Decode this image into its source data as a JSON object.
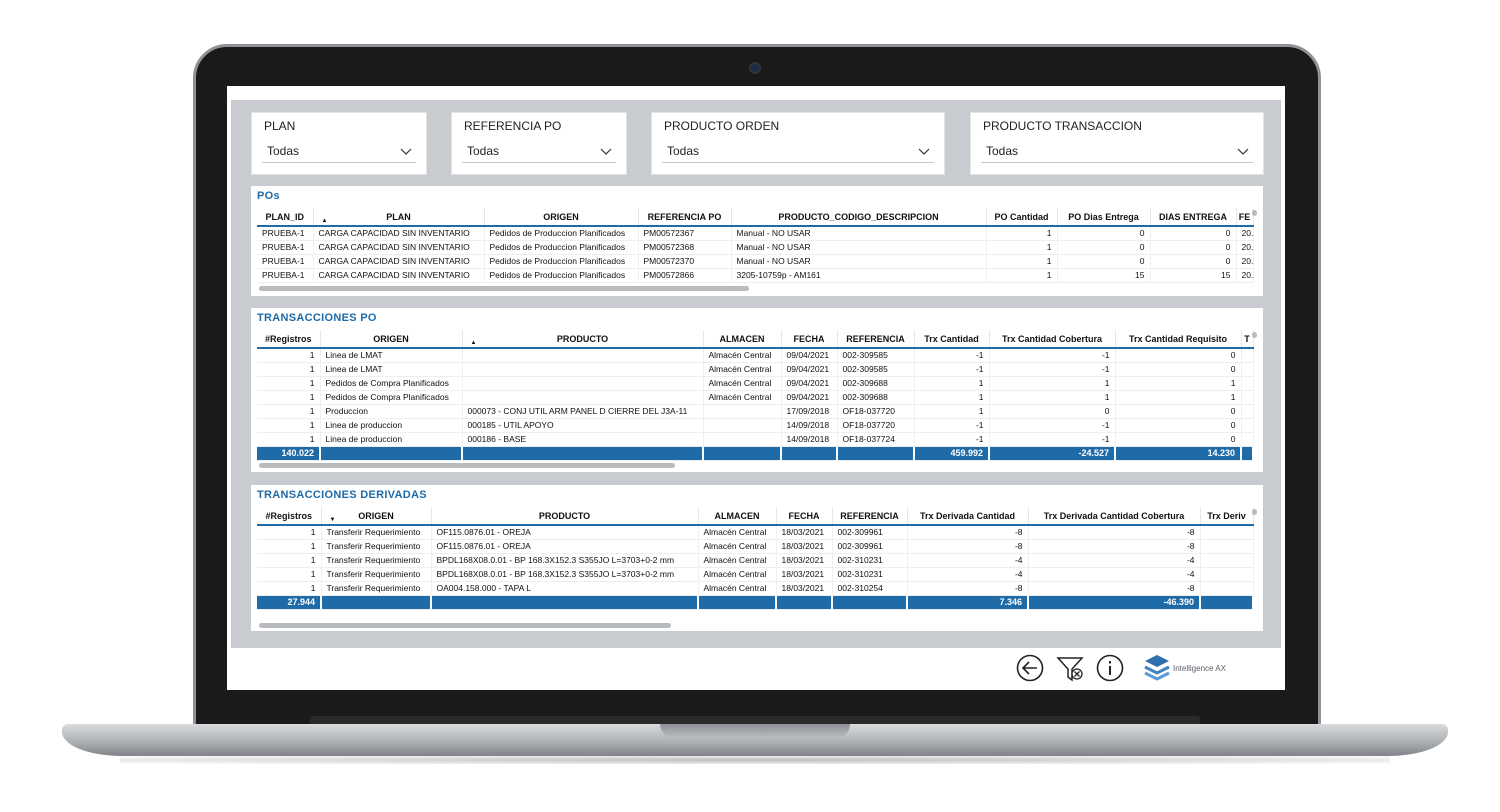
{
  "filters": [
    {
      "label": "PLAN",
      "value": "Todas"
    },
    {
      "label": "REFERENCIA PO",
      "value": "Todas"
    },
    {
      "label": "PRODUCTO ORDEN",
      "value": "Todas"
    },
    {
      "label": "PRODUCTO TRANSACCION",
      "value": "Todas"
    }
  ],
  "pos": {
    "title": "POs",
    "columns": [
      "PLAN_ID",
      "PLAN",
      "ORIGEN",
      "REFERENCIA PO",
      "PRODUCTO_CODIGO_DESCRIPCION",
      "PO Cantidad",
      "PO Dias Entrega",
      "DIAS ENTREGA",
      "FE"
    ],
    "rows": [
      [
        "PRUEBA-1",
        "CARGA CAPACIDAD SIN INVENTARIO",
        "Pedidos de Produccion Planificados",
        "PM00572367",
        "Manual - NO USAR",
        "1",
        "0",
        "0",
        "20."
      ],
      [
        "PRUEBA-1",
        "CARGA CAPACIDAD SIN INVENTARIO",
        "Pedidos de Produccion Planificados",
        "PM00572368",
        "Manual - NO USAR",
        "1",
        "0",
        "0",
        "20."
      ],
      [
        "PRUEBA-1",
        "CARGA CAPACIDAD SIN INVENTARIO",
        "Pedidos de Produccion Planificados",
        "PM00572370",
        "Manual - NO USAR",
        "1",
        "0",
        "0",
        "20."
      ],
      [
        "PRUEBA-1",
        "CARGA CAPACIDAD SIN INVENTARIO",
        "Pedidos de Produccion Planificados",
        "PM00572866",
        "3205-10759p - AM161",
        "1",
        "15",
        "15",
        "20."
      ]
    ]
  },
  "trx": {
    "title": "TRANSACCIONES PO",
    "columns": [
      "#Registros",
      "ORIGEN",
      "PRODUCTO",
      "ALMACEN",
      "FECHA",
      "REFERENCIA",
      "Trx Cantidad",
      "Trx Cantidad Cobertura",
      "Trx Cantidad Requisito",
      "T"
    ],
    "rows": [
      [
        "1",
        "Linea de LMAT",
        "",
        "Almacén Central",
        "09/04/2021",
        "002-309585",
        "-1",
        "-1",
        "0"
      ],
      [
        "1",
        "Linea de LMAT",
        "",
        "Almacén Central",
        "09/04/2021",
        "002-309585",
        "-1",
        "-1",
        "0"
      ],
      [
        "1",
        "Pedidos de Compra Planificados",
        "",
        "Almacén Central",
        "09/04/2021",
        "002-309688",
        "1",
        "1",
        "1"
      ],
      [
        "1",
        "Pedidos de Compra Planificados",
        "",
        "Almacén Central",
        "09/04/2021",
        "002-309688",
        "1",
        "1",
        "1"
      ],
      [
        "1",
        "Produccion",
        "000073 - CONJ UTIL ARM PANEL D CIERRE DEL J3A-11",
        "",
        "17/09/2018",
        "OF18-037720",
        "1",
        "0",
        "0"
      ],
      [
        "1",
        "Linea de produccion",
        "000185 - UTIL APOYO",
        "",
        "14/09/2018",
        "OF18-037720",
        "-1",
        "-1",
        "0"
      ],
      [
        "1",
        "Linea de produccion",
        "000186 - BASE",
        "",
        "14/09/2018",
        "OF18-037724",
        "-1",
        "-1",
        "0"
      ]
    ],
    "totals": [
      "140.022",
      "",
      "",
      "",
      "",
      "",
      "459.992",
      "-24.527",
      "14.230",
      ""
    ]
  },
  "der": {
    "title": "TRANSACCIONES DERIVADAS",
    "columns": [
      "#Registros",
      "ORIGEN",
      "PRODUCTO",
      "ALMACEN",
      "FECHA",
      "REFERENCIA",
      "Trx Derivada Cantidad",
      "Trx Derivada Cantidad Cobertura",
      "Trx Deriv"
    ],
    "rows": [
      [
        "1",
        "Transferir Requerimiento",
        "OF115.0876.01 - OREJA",
        "Almacén Central",
        "18/03/2021",
        "002-309961",
        "-8",
        "-8",
        ""
      ],
      [
        "1",
        "Transferir Requerimiento",
        "OF115.0876.01 - OREJA",
        "Almacén Central",
        "18/03/2021",
        "002-309961",
        "-8",
        "-8",
        ""
      ],
      [
        "1",
        "Transferir Requerimiento",
        "BPDL168X08.0.01 - BP 168.3X152.3 S355JO L=3703+0-2 mm",
        "Almacén Central",
        "18/03/2021",
        "002-310231",
        "-4",
        "-4",
        ""
      ],
      [
        "1",
        "Transferir Requerimiento",
        "BPDL168X08.0.01 - BP 168.3X152.3 S355JO L=3703+0-2 mm",
        "Almacén Central",
        "18/03/2021",
        "002-310231",
        "-4",
        "-4",
        ""
      ],
      [
        "1",
        "Transferir Requerimiento",
        "OA004.158.000 - TAPA L",
        "Almacén Central",
        "18/03/2021",
        "002-310254",
        "-8",
        "-8",
        ""
      ]
    ],
    "totals": [
      "27.944",
      "",
      "",
      "",
      "",
      "",
      "7.346",
      "-46.390",
      ""
    ]
  },
  "footer": {
    "icons": [
      "back-arrow-icon",
      "clear-filter-icon",
      "info-icon"
    ],
    "logo_text": "Intelligence AX"
  }
}
